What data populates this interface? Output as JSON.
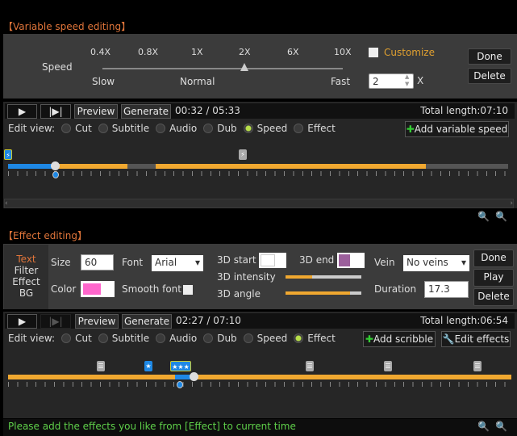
{
  "speed_panel": {
    "title": "【Variable speed editing】",
    "speed_label": "Speed",
    "ticks": [
      "0.4X",
      "0.8X",
      "1X",
      "2X",
      "6X",
      "10X"
    ],
    "selected_speed": "2X",
    "slow": "Slow",
    "normal": "Normal",
    "fast": "Fast",
    "customize": "Customize",
    "customize_checked": false,
    "custom_value": "2",
    "unit": "X",
    "done": "Done",
    "delete": "Delete"
  },
  "speed_toolbar": {
    "preview": "Preview",
    "generate": "Generate",
    "time": "00:32 / 05:33",
    "total": "Total length:07:10",
    "edit_view": "Edit view:",
    "views": [
      "Cut",
      "Subtitle",
      "Audio",
      "Dub",
      "Speed",
      "Effect"
    ],
    "selected_view": "Speed",
    "add_button": "Add variable speed"
  },
  "effect_panel": {
    "title": "【Effect editing】",
    "tabs": [
      "Text",
      "Filter",
      "Effect",
      "BG"
    ],
    "active_tab": "Text",
    "size_label": "Size",
    "size": "60",
    "font_label": "Font",
    "font": "Arial",
    "color_label": "Color",
    "color": "#ff66cc",
    "smooth_font": "Smooth font",
    "start_label": "3D start",
    "start_color": "#ffffff",
    "end_label": "3D end",
    "end_color": "#9b5f9b",
    "intensity_label": "3D intensity",
    "intensity": 35,
    "angle_label": "3D angle",
    "angle": 85,
    "vein_label": "Vein",
    "vein": "No veins",
    "duration_label": "Duration",
    "duration": "17.3",
    "done": "Done",
    "play": "Play",
    "delete": "Delete"
  },
  "effect_toolbar": {
    "preview": "Preview",
    "generate": "Generate",
    "time": "02:27 / 07:10",
    "total": "Total length:06:54",
    "edit_view": "Edit view:",
    "views": [
      "Cut",
      "Subtitle",
      "Audio",
      "Dub",
      "Speed",
      "Effect"
    ],
    "selected_view": "Effect",
    "add_scribble": "Add scribble",
    "edit_effects": "Edit effects"
  },
  "status": "Please add the effects you like from [Effect] to current time",
  "colors": {
    "accent": "#e0753a",
    "bar": "#f0a830",
    "playhead": "#1e88e5",
    "status": "#5fd04a"
  }
}
